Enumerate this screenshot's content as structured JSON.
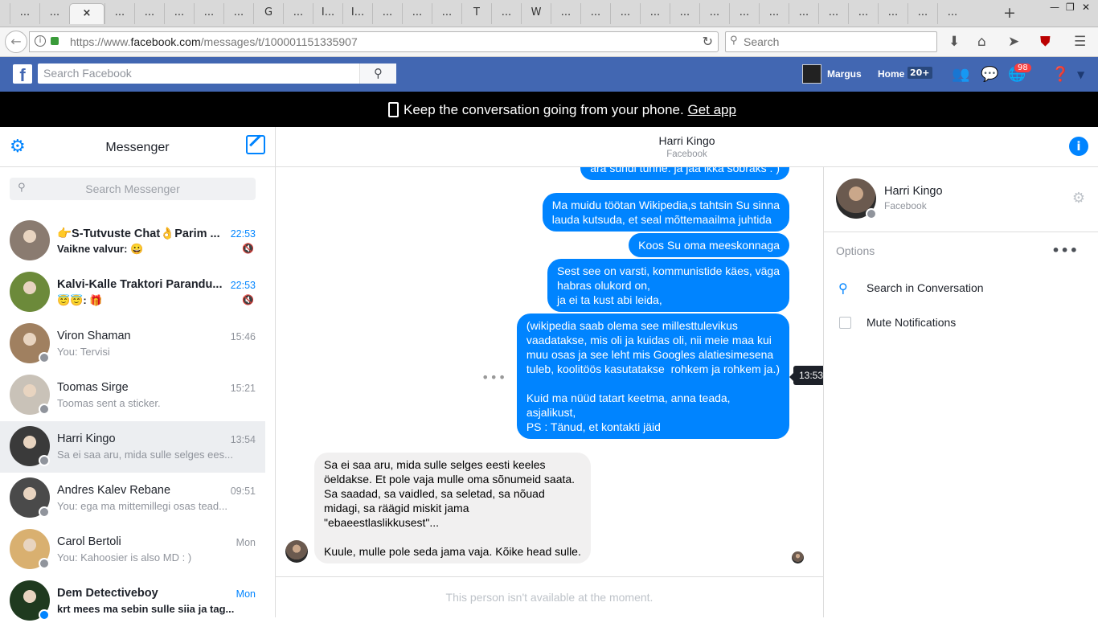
{
  "browser": {
    "tabs": [
      {
        "label": "..."
      },
      {
        "label": "..."
      },
      {
        "label": "×",
        "active": true
      },
      {
        "label": "..."
      },
      {
        "label": "..."
      },
      {
        "label": "..."
      },
      {
        "label": "..."
      },
      {
        "label": "..."
      },
      {
        "label": "G"
      },
      {
        "label": "..."
      },
      {
        "label": "I..."
      },
      {
        "label": "I..."
      },
      {
        "label": "..."
      },
      {
        "label": "..."
      },
      {
        "label": "..."
      },
      {
        "label": "T"
      },
      {
        "label": "..."
      },
      {
        "label": "W"
      },
      {
        "label": "..."
      },
      {
        "label": "..."
      },
      {
        "label": "..."
      },
      {
        "label": "..."
      },
      {
        "label": "..."
      },
      {
        "label": "..."
      },
      {
        "label": "..."
      },
      {
        "label": "..."
      },
      {
        "label": "..."
      },
      {
        "label": "..."
      },
      {
        "label": "..."
      },
      {
        "label": "..."
      },
      {
        "label": "..."
      },
      {
        "label": "..."
      },
      {
        "label": "..."
      }
    ],
    "url_prefix": "https://www.",
    "url_domain": "facebook.com",
    "url_path": "/messages/t/100001151335907",
    "search_placeholder": "Search"
  },
  "fb": {
    "search_placeholder": "Search Facebook",
    "user_name": "Margus",
    "home_label": "Home",
    "home_count": "20+",
    "notif_count": "98"
  },
  "banner": {
    "text": "Keep the conversation going from your phone.",
    "link": "Get app"
  },
  "messenger": {
    "title": "Messenger",
    "search_placeholder": "Search Messenger",
    "conversations": [
      {
        "name": "👉S-Tutvuste Chat👌Parim ...",
        "preview": "Vaikne valvur: 😀",
        "time": "22:53",
        "unread": true
      },
      {
        "name": "Kalvi-Kalle Traktori Parandu...",
        "preview": "😇😇: 🎁",
        "time": "22:53",
        "unread": true
      },
      {
        "name": "Viron Shaman",
        "preview": "You: Tervisi",
        "time": "15:46"
      },
      {
        "name": "Toomas Sirge",
        "preview": "Toomas sent a sticker.",
        "time": "15:21"
      },
      {
        "name": "Harri Kingo",
        "preview": "Sa ei saa aru, mida sulle selges ees...",
        "time": "13:54",
        "selected": true
      },
      {
        "name": "Andres Kalev Rebane",
        "preview": "You: ega ma mittemillegi osas tead...",
        "time": "09:51"
      },
      {
        "name": "Carol Bertoli",
        "preview": "You: Kahoosier is also MD : )",
        "time": "Mon"
      },
      {
        "name": "Dem Detectiveboy",
        "preview": "krt mees ma sebin sulle siia ja tag...",
        "time": "Mon",
        "unread": true
      }
    ]
  },
  "thread": {
    "contact_name": "Harri Kingo",
    "contact_sub": "Facebook",
    "messages": [
      {
        "dir": "out",
        "text": "ära sundi tunne. ja jää ikka sõbraks : )"
      },
      {
        "dir": "out",
        "text": "Ma muidu töötan Wikipedia,s tahtsin Su sinna\nlauda kutsuda, et seal mõttemaailma juhtida"
      },
      {
        "dir": "out",
        "text": "Koos Su oma meeskonnaga"
      },
      {
        "dir": "out",
        "text": "Sest see on varsti, kommunistide käes, väga\nhabras olukord on,\nja ei ta kust abi leida,"
      },
      {
        "dir": "out",
        "text": "(wikipedia saab olema see millesttulevikus\nvaadatakse, mis oli ja kuidas oli, nii meie maa kui\nmuu osas ja see leht mis Googles alatiesimesena\ntuleb, koolitöös kasutatakse  rohkem ja rohkem ja.)\n\nKuid ma nüüd tatart keetma, anna teada,\nasjalikust,\nPS : Tänud, et kontakti jäid"
      },
      {
        "dir": "in",
        "text": "Sa ei saa aru, mida sulle selges eesti keeles\nöeldakse. Et pole vaja mulle oma sõnumeid saata.\nSa saadad, sa vaidled, sa seletad, sa nõuad\nmidagi, sa räägid miskit jama\n\"ebaeestlaslikkusest\"...\n\nKuule, mulle pole seda jama vaja. Kõike head sulle."
      }
    ],
    "tooltip_time": "13:53",
    "unavailable": "This person isn't available at the moment."
  },
  "details": {
    "name": "Harri Kingo",
    "sub": "Facebook",
    "options_label": "Options",
    "search_in_conv": "Search in Conversation",
    "mute": "Mute Notifications"
  }
}
